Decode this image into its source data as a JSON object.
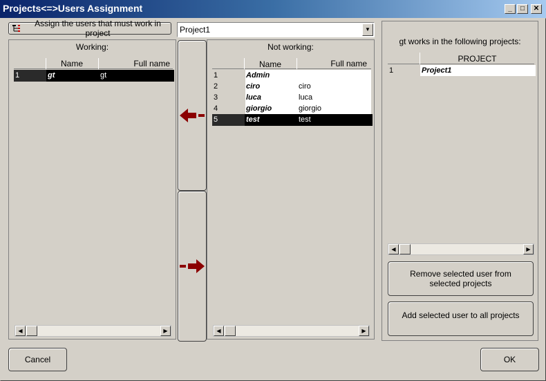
{
  "window": {
    "title": "Projects<=>Users Assignment",
    "minimize": "_",
    "maximize": "□",
    "close": "✕"
  },
  "top": {
    "assign_button": "Assign the users that must work in project",
    "project_select": "Project1",
    "combo_arrow": "▼"
  },
  "working": {
    "title": "Working:",
    "columns": [
      "Name",
      "Full name"
    ],
    "rows": [
      {
        "num": "1",
        "name": "gt",
        "full": "gt",
        "selected": true
      }
    ]
  },
  "not_working": {
    "title": "Not working:",
    "columns": [
      "Name",
      "Full name"
    ],
    "rows": [
      {
        "num": "1",
        "name": "Admin",
        "full": "",
        "selected": false
      },
      {
        "num": "2",
        "name": "ciro",
        "full": "ciro",
        "selected": false
      },
      {
        "num": "3",
        "name": "luca",
        "full": "luca",
        "selected": false
      },
      {
        "num": "4",
        "name": "giorgio",
        "full": "giorgio",
        "selected": false
      },
      {
        "num": "5",
        "name": "test",
        "full": "test",
        "selected": true
      }
    ]
  },
  "right_panel": {
    "title": "gt works in the following projects:",
    "column": "PROJECT",
    "rows": [
      {
        "num": "1",
        "project": "Project1"
      }
    ],
    "remove_button": "Remove selected user from selected projects",
    "add_button": "Add selected user to all projects"
  },
  "scroll": {
    "left": "◀",
    "right": "▶"
  },
  "footer": {
    "cancel": "Cancel",
    "ok": "OK"
  },
  "colors": {
    "title_start": "#0a246a",
    "title_end": "#a6caf0",
    "arrow": "#8b0000",
    "face": "#d4d0c8"
  }
}
